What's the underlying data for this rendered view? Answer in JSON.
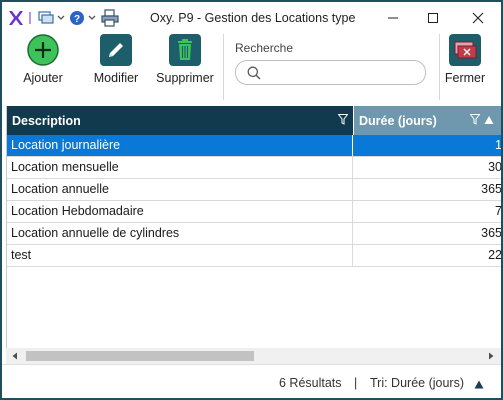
{
  "window": {
    "title": "Oxy. P9 - Gestion des Locations type"
  },
  "toolbar": {
    "add_label": "Ajouter",
    "edit_label": "Modifier",
    "delete_label": "Supprimer",
    "close_label": "Fermer"
  },
  "search": {
    "label": "Recherche",
    "value": "",
    "placeholder": ""
  },
  "grid": {
    "columns": [
      "Description",
      "Durée (jours)"
    ],
    "rows": [
      {
        "description": "Location journalière",
        "duration": "1"
      },
      {
        "description": "Location mensuelle",
        "duration": "30"
      },
      {
        "description": "Location annuelle",
        "duration": "365"
      },
      {
        "description": "Location Hebdomadaire",
        "duration": "7"
      },
      {
        "description": "Location annuelle de cylindres",
        "duration": "365"
      },
      {
        "description": "test",
        "duration": "22"
      }
    ],
    "selected_row": 0
  },
  "status": {
    "results": "6 Résultats",
    "separator": "|",
    "sort": "Tri: Durée (jours)"
  },
  "colors": {
    "accent_purple": "#6b2fd6",
    "header_dark": "#113a4f",
    "header_sorted": "#6f97ad",
    "selection": "#0a78d7",
    "add_green": "#3ec25a",
    "teal_button": "#1d5e6a",
    "close_red": "#c23b4a"
  }
}
